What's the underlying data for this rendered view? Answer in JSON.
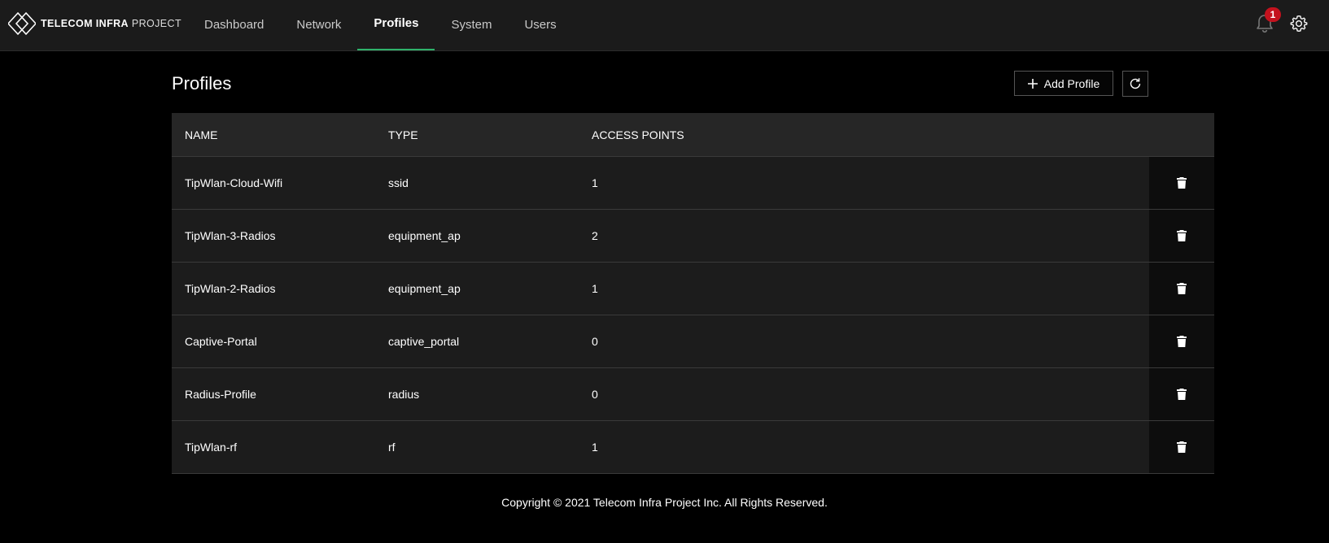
{
  "brand": {
    "name_bold": "TELECOM INFRA",
    "name_light": "PROJECT"
  },
  "nav": {
    "items": [
      {
        "label": "Dashboard"
      },
      {
        "label": "Network"
      },
      {
        "label": "Profiles",
        "active": true
      },
      {
        "label": "System"
      },
      {
        "label": "Users"
      }
    ]
  },
  "header": {
    "notification_count": "1",
    "accent_color": "#2fb36b",
    "badge_color": "#c4121e"
  },
  "page": {
    "title": "Profiles",
    "add_button_label": "Add Profile"
  },
  "table": {
    "columns": [
      "NAME",
      "TYPE",
      "ACCESS POINTS"
    ],
    "rows": [
      {
        "name": "TipWlan-Cloud-Wifi",
        "type": "ssid",
        "access_points": "1"
      },
      {
        "name": "TipWlan-3-Radios",
        "type": "equipment_ap",
        "access_points": "2"
      },
      {
        "name": "TipWlan-2-Radios",
        "type": "equipment_ap",
        "access_points": "1"
      },
      {
        "name": "Captive-Portal",
        "type": "captive_portal",
        "access_points": "0"
      },
      {
        "name": "Radius-Profile",
        "type": "radius",
        "access_points": "0"
      },
      {
        "name": "TipWlan-rf",
        "type": "rf",
        "access_points": "1"
      }
    ]
  },
  "icons": [
    "logo-icon",
    "bell-icon",
    "gear-icon",
    "plus-icon",
    "refresh-icon",
    "trash-icon"
  ],
  "footer": {
    "copyright": "Copyright © 2021 Telecom Infra Project Inc. All Rights Reserved."
  }
}
